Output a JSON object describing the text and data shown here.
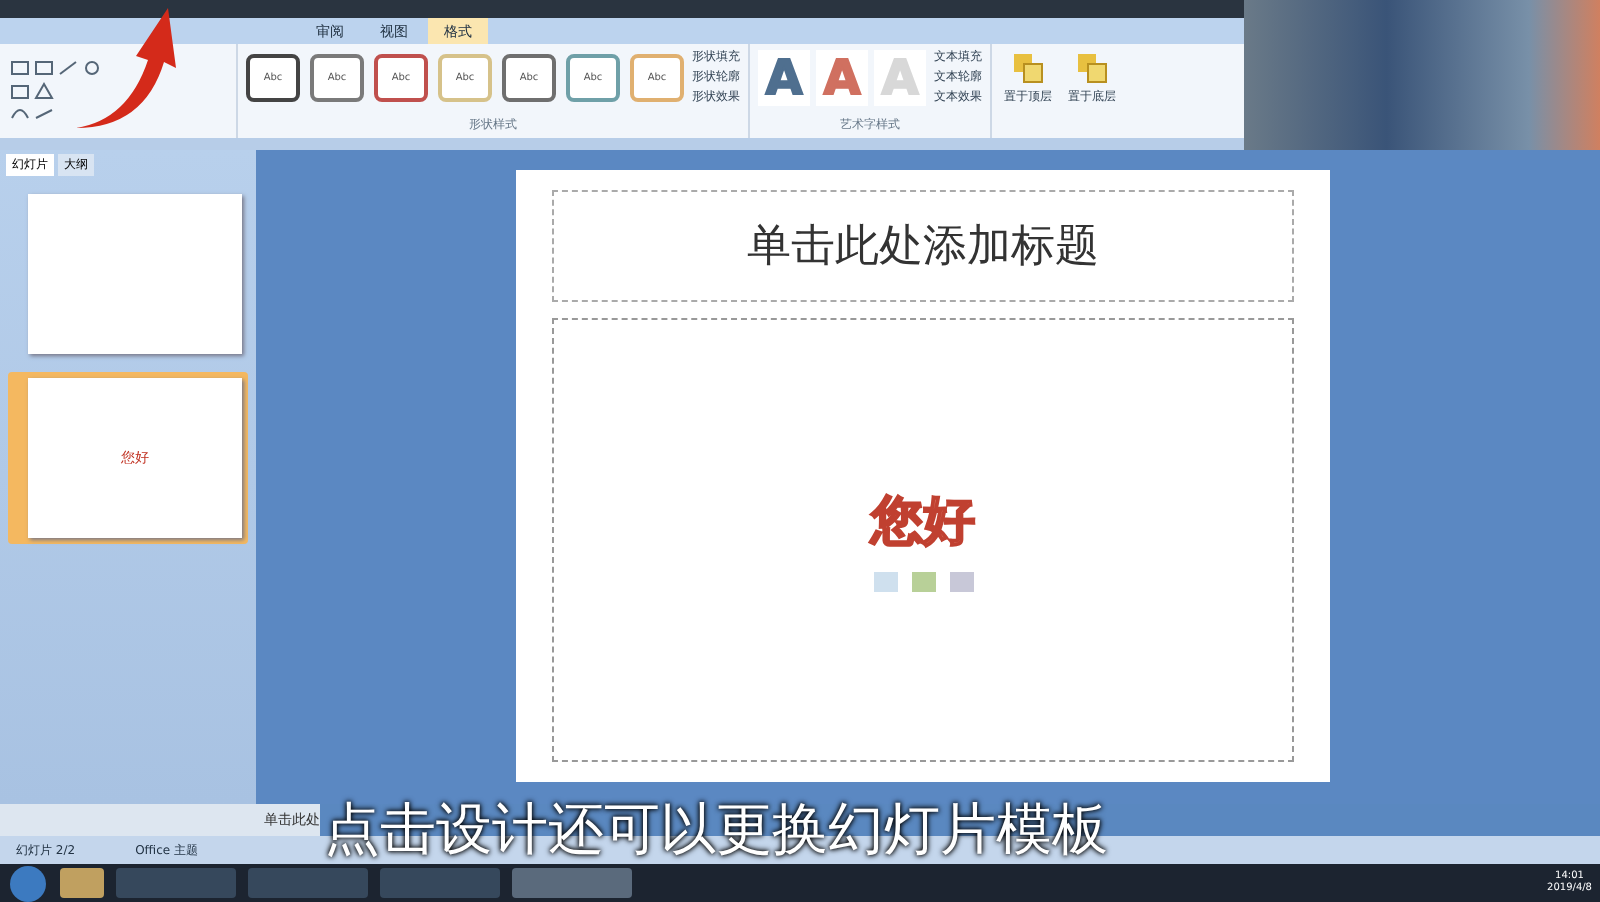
{
  "ribbon": {
    "tabs": [
      {
        "label": "审阅",
        "selected": false
      },
      {
        "label": "视图",
        "selected": false
      },
      {
        "label": "格式",
        "selected": true
      }
    ],
    "style_swatches": [
      {
        "label": "Abc",
        "color": "#444444"
      },
      {
        "label": "Abc",
        "color": "#7a7a7a"
      },
      {
        "label": "Abc",
        "color": "#c0504d"
      },
      {
        "label": "Abc",
        "color": "#d6c28a"
      },
      {
        "label": "Abc",
        "color": "#6f6f6f"
      },
      {
        "label": "Abc",
        "color": "#6fa0a8"
      },
      {
        "label": "Abc",
        "color": "#e0b070"
      }
    ],
    "shape_commands": [
      "形状填充",
      "形状轮廓",
      "形状效果"
    ],
    "shape_group_label": "形状样式",
    "wordart_samples": [
      {
        "label": "A",
        "color": "#4f6f8f"
      },
      {
        "label": "A",
        "color": "#d07060"
      },
      {
        "label": "A",
        "color": "#d8d8d8"
      }
    ],
    "text_commands": [
      "文本填充",
      "文本轮廓",
      "文本效果"
    ],
    "wordart_group_label": "艺术字样式",
    "arrange_buttons": [
      "置于顶层",
      "置于底层"
    ]
  },
  "slides_panel": {
    "tabs": [
      {
        "label": "幻灯片",
        "selected": true
      },
      {
        "label": "大纲",
        "selected": false
      }
    ],
    "thumbnails": [
      {
        "selected": false
      },
      {
        "selected": true,
        "text": "您好"
      }
    ]
  },
  "slide": {
    "title_placeholder": "单击此处添加标题",
    "wordart": "您好"
  },
  "notes": {
    "placeholder": "单击此处"
  },
  "status_bar": [
    "幻灯片 2/2",
    "Office 主题"
  ],
  "taskbar": {
    "time": "14:01",
    "date": "2019/4/8"
  },
  "caption": "点击设计还可以更换幻灯片模板"
}
